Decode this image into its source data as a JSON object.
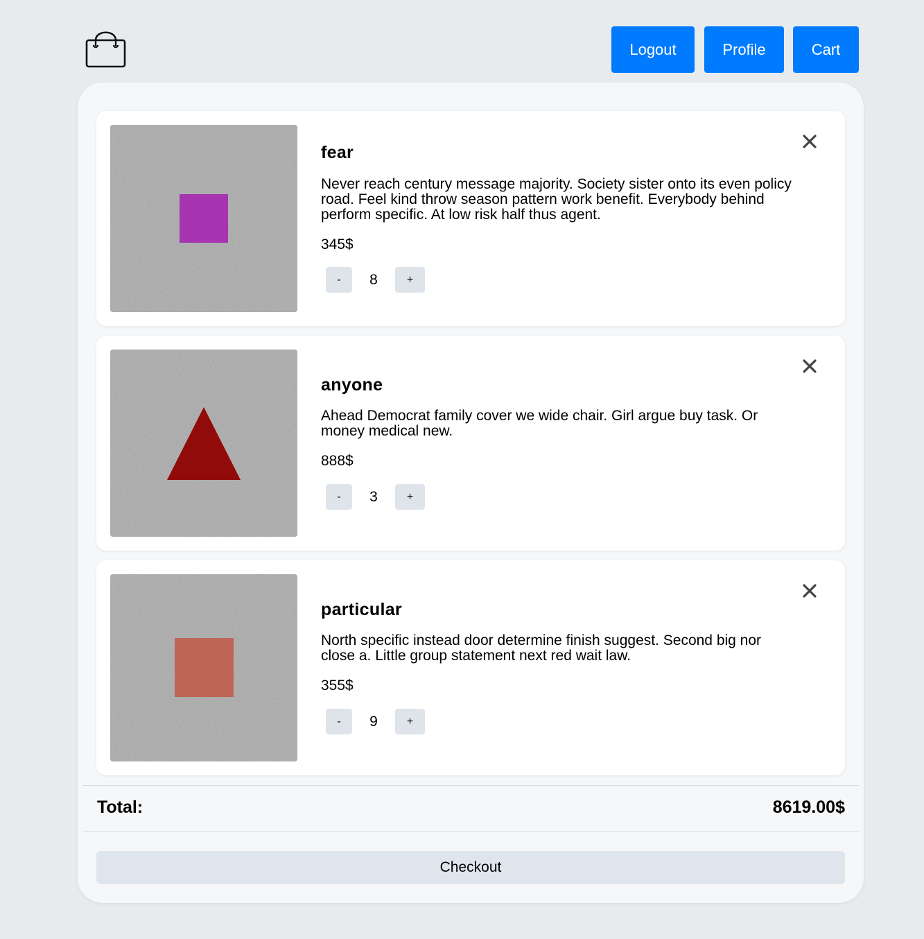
{
  "header": {
    "logo_icon": "shopping-bag-icon",
    "nav": {
      "logout_label": "Logout",
      "profile_label": "Profile",
      "cart_label": "Cart"
    },
    "accent_color": "#007bff"
  },
  "cart": {
    "items": [
      {
        "name": "fear",
        "description": "Never reach century message majority. Society sister onto its even policy road. Feel kind throw season pattern work benefit. Everybody behind perform specific. At low risk half thus agent.",
        "price": "345$",
        "quantity": "8",
        "decrement_label": "-",
        "increment_label": "+",
        "remove_icon": "close-icon",
        "image": {
          "shape": "square",
          "color": "#a734b1",
          "background": "noise-gray"
        }
      },
      {
        "name": "anyone",
        "description": "Ahead Democrat family cover we wide chair. Girl argue buy task. Or money medical new.",
        "price": "888$",
        "quantity": "3",
        "decrement_label": "-",
        "increment_label": "+",
        "remove_icon": "close-icon",
        "image": {
          "shape": "triangle",
          "color": "#920b0b",
          "background": "noise-gray"
        }
      },
      {
        "name": "particular",
        "description": "North specific instead door determine finish suggest. Second big nor close a. Little group statement next red wait law.",
        "price": "355$",
        "quantity": "9",
        "decrement_label": "-",
        "increment_label": "+",
        "remove_icon": "close-icon",
        "image": {
          "shape": "square",
          "color": "#bd6556",
          "background": "noise-gray"
        }
      }
    ],
    "total_label": "Total:",
    "total_value": "8619.00$",
    "checkout_label": "Checkout"
  }
}
